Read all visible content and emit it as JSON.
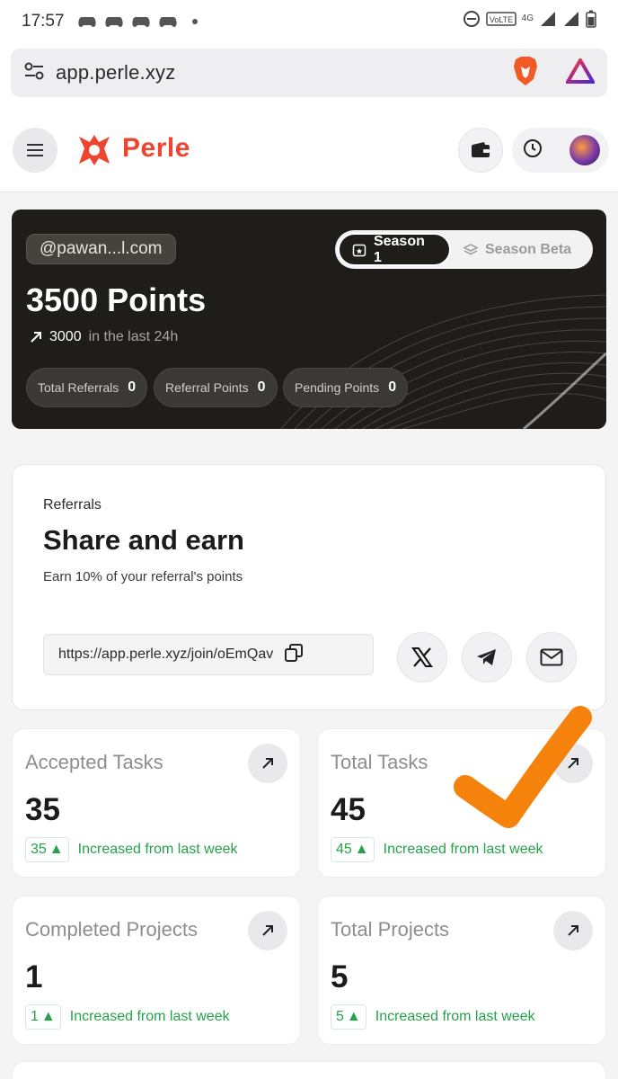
{
  "status_bar": {
    "time": "17:57",
    "network": "4G"
  },
  "browser": {
    "url": "app.perle.xyz"
  },
  "app": {
    "brand": "Perle"
  },
  "hero": {
    "email": "@pawan...l.com",
    "seasons": [
      "Season 1",
      "Season Beta"
    ],
    "active_season": "Season 1",
    "points": "3500 Points",
    "gain_value": "3000",
    "gain_text": "in the last 24h",
    "stats": [
      {
        "label": "Total Referrals",
        "value": "0"
      },
      {
        "label": "Referral Points",
        "value": "0"
      },
      {
        "label": "Pending Points",
        "value": "0"
      }
    ]
  },
  "referrals": {
    "eyebrow": "Referrals",
    "title": "Share and earn",
    "subtitle": "Earn 10% of your referral's points",
    "link": "https://app.perle.xyz/join/oEmQav"
  },
  "cards": [
    {
      "label": "Accepted Tasks",
      "value": "35",
      "delta": "35",
      "trend_text": "Increased from last week"
    },
    {
      "label": "Total Tasks",
      "value": "45",
      "delta": "45",
      "trend_text": "Increased from last week"
    },
    {
      "label": "Completed Projects",
      "value": "1",
      "delta": "1",
      "trend_text": "Increased from last week"
    },
    {
      "label": "Total Projects",
      "value": "5",
      "delta": "5",
      "trend_text": "Increased from last week"
    }
  ],
  "colors": {
    "brand": "#ef4530",
    "hero_bg": "#1f1d1a",
    "trend_green": "#22a34a",
    "annotation_orange": "#f5820b"
  }
}
